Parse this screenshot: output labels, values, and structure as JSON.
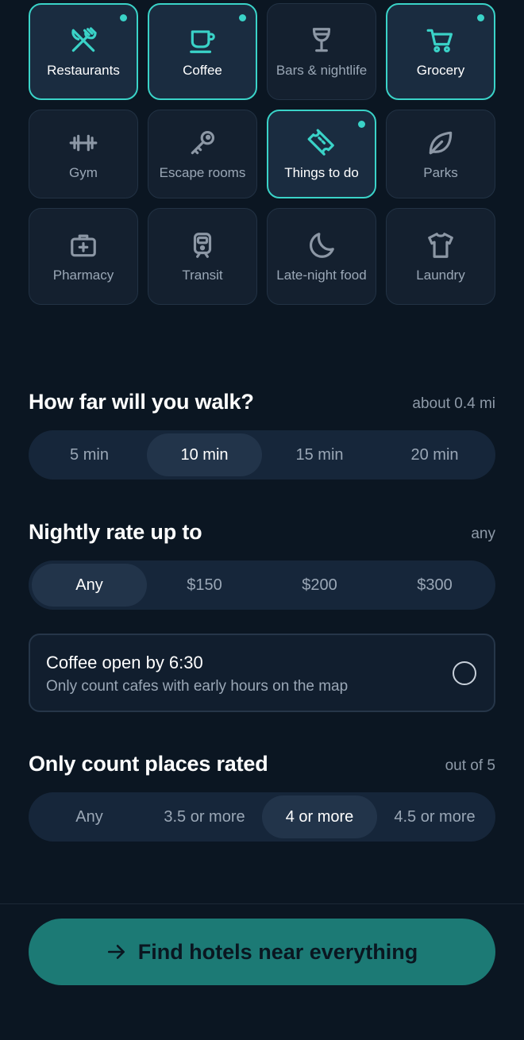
{
  "categories": [
    {
      "label": "Restaurants",
      "icon": "utensils-icon",
      "selected": true
    },
    {
      "label": "Coffee",
      "icon": "coffee-cup-icon",
      "selected": true
    },
    {
      "label": "Bars & nightlife",
      "icon": "wine-glass-icon",
      "selected": false
    },
    {
      "label": "Grocery",
      "icon": "shopping-cart-icon",
      "selected": true
    },
    {
      "label": "Gym",
      "icon": "dumbbell-icon",
      "selected": false
    },
    {
      "label": "Escape rooms",
      "icon": "key-icon",
      "selected": false
    },
    {
      "label": "Things to do",
      "icon": "ticket-icon",
      "selected": true
    },
    {
      "label": "Parks",
      "icon": "leaf-icon",
      "selected": false
    },
    {
      "label": "Pharmacy",
      "icon": "medical-kit-icon",
      "selected": false
    },
    {
      "label": "Transit",
      "icon": "train-icon",
      "selected": false
    },
    {
      "label": "Late-night food",
      "icon": "moon-icon",
      "selected": false
    },
    {
      "label": "Laundry",
      "icon": "shirt-icon",
      "selected": false
    }
  ],
  "walk": {
    "title": "How far will you walk?",
    "hint": "about 0.4 mi",
    "options": [
      "5 min",
      "10 min",
      "15 min",
      "20 min"
    ],
    "selected": "10 min"
  },
  "rate": {
    "title": "Nightly rate up to",
    "hint": "any",
    "options": [
      "Any",
      "$150",
      "$200",
      "$300"
    ],
    "selected": "Any"
  },
  "coffee_toggle": {
    "title": "Coffee open by 6:30",
    "subtitle": "Only count cafes with early hours on the map",
    "checked": false
  },
  "rating": {
    "title": "Only count places rated",
    "hint": "out of 5",
    "options": [
      "Any",
      "3.5 or more",
      "4 or more",
      "4.5 or more"
    ],
    "selected": "4 or more"
  },
  "cta": {
    "label": "Find hotels near everything",
    "icon": "arrow-right-icon"
  },
  "colors": {
    "background": "#0b1622",
    "accent": "#3ad3c8",
    "cta": "#1c7a75"
  }
}
